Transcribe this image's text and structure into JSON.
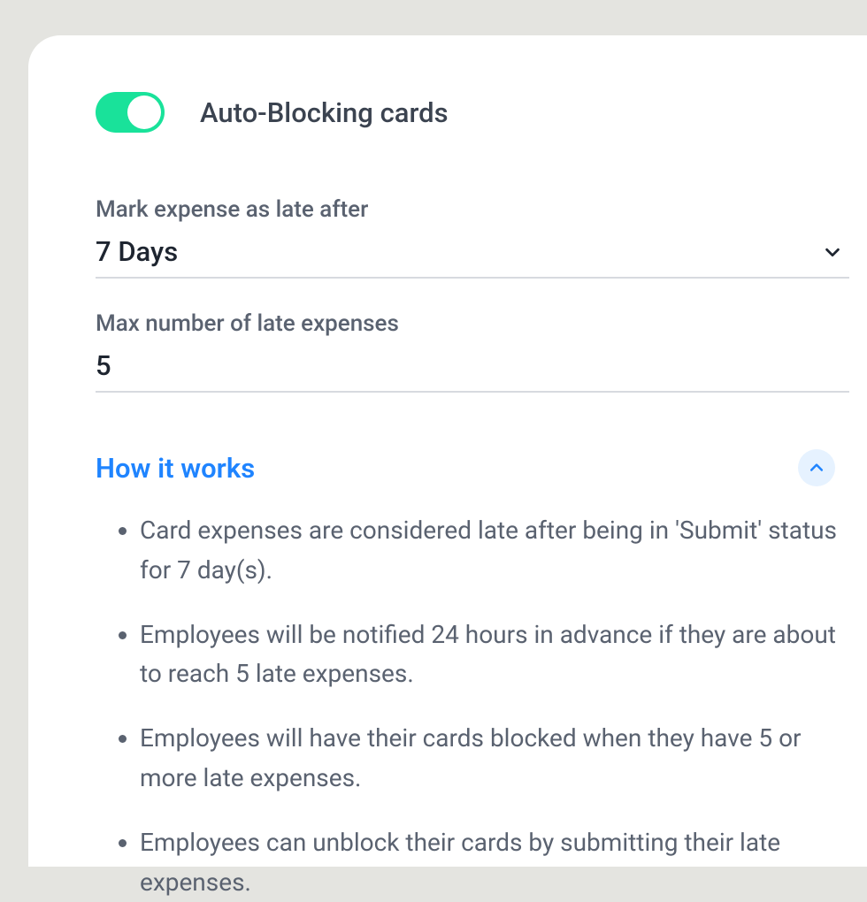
{
  "toggle": {
    "title": "Auto-Blocking cards",
    "enabled": true
  },
  "late_after": {
    "label": "Mark expense as late after",
    "value": "7 Days"
  },
  "max_late": {
    "label": "Max number of late expenses",
    "value": "5"
  },
  "how_it_works": {
    "title": "How it works",
    "expanded": true,
    "bullets": [
      "Card expenses are considered late after being in 'Submit' status for 7 day(s).",
      "Employees will be notified 24 hours in advance if they are about to reach 5 late expenses.",
      "Employees will have their cards blocked when they have 5 or more late expenses.",
      "Employees can unblock their cards by submitting their late expenses."
    ]
  }
}
